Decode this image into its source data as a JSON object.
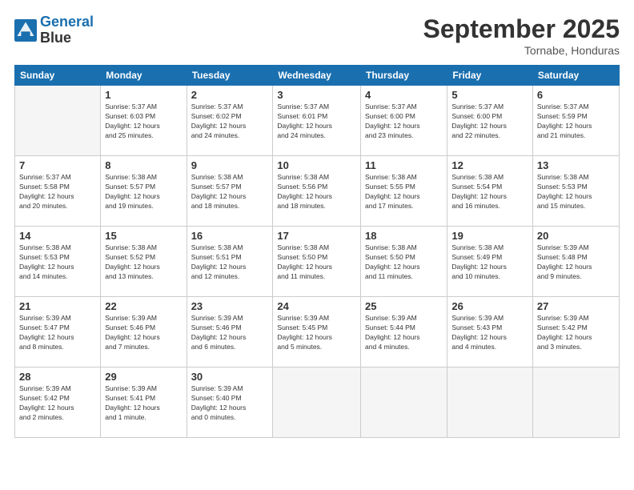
{
  "header": {
    "logo_line1": "General",
    "logo_line2": "Blue",
    "month": "September 2025",
    "location": "Tornabe, Honduras"
  },
  "days_of_week": [
    "Sunday",
    "Monday",
    "Tuesday",
    "Wednesday",
    "Thursday",
    "Friday",
    "Saturday"
  ],
  "weeks": [
    [
      {
        "day": "",
        "info": ""
      },
      {
        "day": "1",
        "info": "Sunrise: 5:37 AM\nSunset: 6:03 PM\nDaylight: 12 hours\nand 25 minutes."
      },
      {
        "day": "2",
        "info": "Sunrise: 5:37 AM\nSunset: 6:02 PM\nDaylight: 12 hours\nand 24 minutes."
      },
      {
        "day": "3",
        "info": "Sunrise: 5:37 AM\nSunset: 6:01 PM\nDaylight: 12 hours\nand 24 minutes."
      },
      {
        "day": "4",
        "info": "Sunrise: 5:37 AM\nSunset: 6:00 PM\nDaylight: 12 hours\nand 23 minutes."
      },
      {
        "day": "5",
        "info": "Sunrise: 5:37 AM\nSunset: 6:00 PM\nDaylight: 12 hours\nand 22 minutes."
      },
      {
        "day": "6",
        "info": "Sunrise: 5:37 AM\nSunset: 5:59 PM\nDaylight: 12 hours\nand 21 minutes."
      }
    ],
    [
      {
        "day": "7",
        "info": "Sunrise: 5:37 AM\nSunset: 5:58 PM\nDaylight: 12 hours\nand 20 minutes."
      },
      {
        "day": "8",
        "info": "Sunrise: 5:38 AM\nSunset: 5:57 PM\nDaylight: 12 hours\nand 19 minutes."
      },
      {
        "day": "9",
        "info": "Sunrise: 5:38 AM\nSunset: 5:57 PM\nDaylight: 12 hours\nand 18 minutes."
      },
      {
        "day": "10",
        "info": "Sunrise: 5:38 AM\nSunset: 5:56 PM\nDaylight: 12 hours\nand 18 minutes."
      },
      {
        "day": "11",
        "info": "Sunrise: 5:38 AM\nSunset: 5:55 PM\nDaylight: 12 hours\nand 17 minutes."
      },
      {
        "day": "12",
        "info": "Sunrise: 5:38 AM\nSunset: 5:54 PM\nDaylight: 12 hours\nand 16 minutes."
      },
      {
        "day": "13",
        "info": "Sunrise: 5:38 AM\nSunset: 5:53 PM\nDaylight: 12 hours\nand 15 minutes."
      }
    ],
    [
      {
        "day": "14",
        "info": "Sunrise: 5:38 AM\nSunset: 5:53 PM\nDaylight: 12 hours\nand 14 minutes."
      },
      {
        "day": "15",
        "info": "Sunrise: 5:38 AM\nSunset: 5:52 PM\nDaylight: 12 hours\nand 13 minutes."
      },
      {
        "day": "16",
        "info": "Sunrise: 5:38 AM\nSunset: 5:51 PM\nDaylight: 12 hours\nand 12 minutes."
      },
      {
        "day": "17",
        "info": "Sunrise: 5:38 AM\nSunset: 5:50 PM\nDaylight: 12 hours\nand 11 minutes."
      },
      {
        "day": "18",
        "info": "Sunrise: 5:38 AM\nSunset: 5:50 PM\nDaylight: 12 hours\nand 11 minutes."
      },
      {
        "day": "19",
        "info": "Sunrise: 5:38 AM\nSunset: 5:49 PM\nDaylight: 12 hours\nand 10 minutes."
      },
      {
        "day": "20",
        "info": "Sunrise: 5:39 AM\nSunset: 5:48 PM\nDaylight: 12 hours\nand 9 minutes."
      }
    ],
    [
      {
        "day": "21",
        "info": "Sunrise: 5:39 AM\nSunset: 5:47 PM\nDaylight: 12 hours\nand 8 minutes."
      },
      {
        "day": "22",
        "info": "Sunrise: 5:39 AM\nSunset: 5:46 PM\nDaylight: 12 hours\nand 7 minutes."
      },
      {
        "day": "23",
        "info": "Sunrise: 5:39 AM\nSunset: 5:46 PM\nDaylight: 12 hours\nand 6 minutes."
      },
      {
        "day": "24",
        "info": "Sunrise: 5:39 AM\nSunset: 5:45 PM\nDaylight: 12 hours\nand 5 minutes."
      },
      {
        "day": "25",
        "info": "Sunrise: 5:39 AM\nSunset: 5:44 PM\nDaylight: 12 hours\nand 4 minutes."
      },
      {
        "day": "26",
        "info": "Sunrise: 5:39 AM\nSunset: 5:43 PM\nDaylight: 12 hours\nand 4 minutes."
      },
      {
        "day": "27",
        "info": "Sunrise: 5:39 AM\nSunset: 5:42 PM\nDaylight: 12 hours\nand 3 minutes."
      }
    ],
    [
      {
        "day": "28",
        "info": "Sunrise: 5:39 AM\nSunset: 5:42 PM\nDaylight: 12 hours\nand 2 minutes."
      },
      {
        "day": "29",
        "info": "Sunrise: 5:39 AM\nSunset: 5:41 PM\nDaylight: 12 hours\nand 1 minute."
      },
      {
        "day": "30",
        "info": "Sunrise: 5:39 AM\nSunset: 5:40 PM\nDaylight: 12 hours\nand 0 minutes."
      },
      {
        "day": "",
        "info": ""
      },
      {
        "day": "",
        "info": ""
      },
      {
        "day": "",
        "info": ""
      },
      {
        "day": "",
        "info": ""
      }
    ]
  ]
}
